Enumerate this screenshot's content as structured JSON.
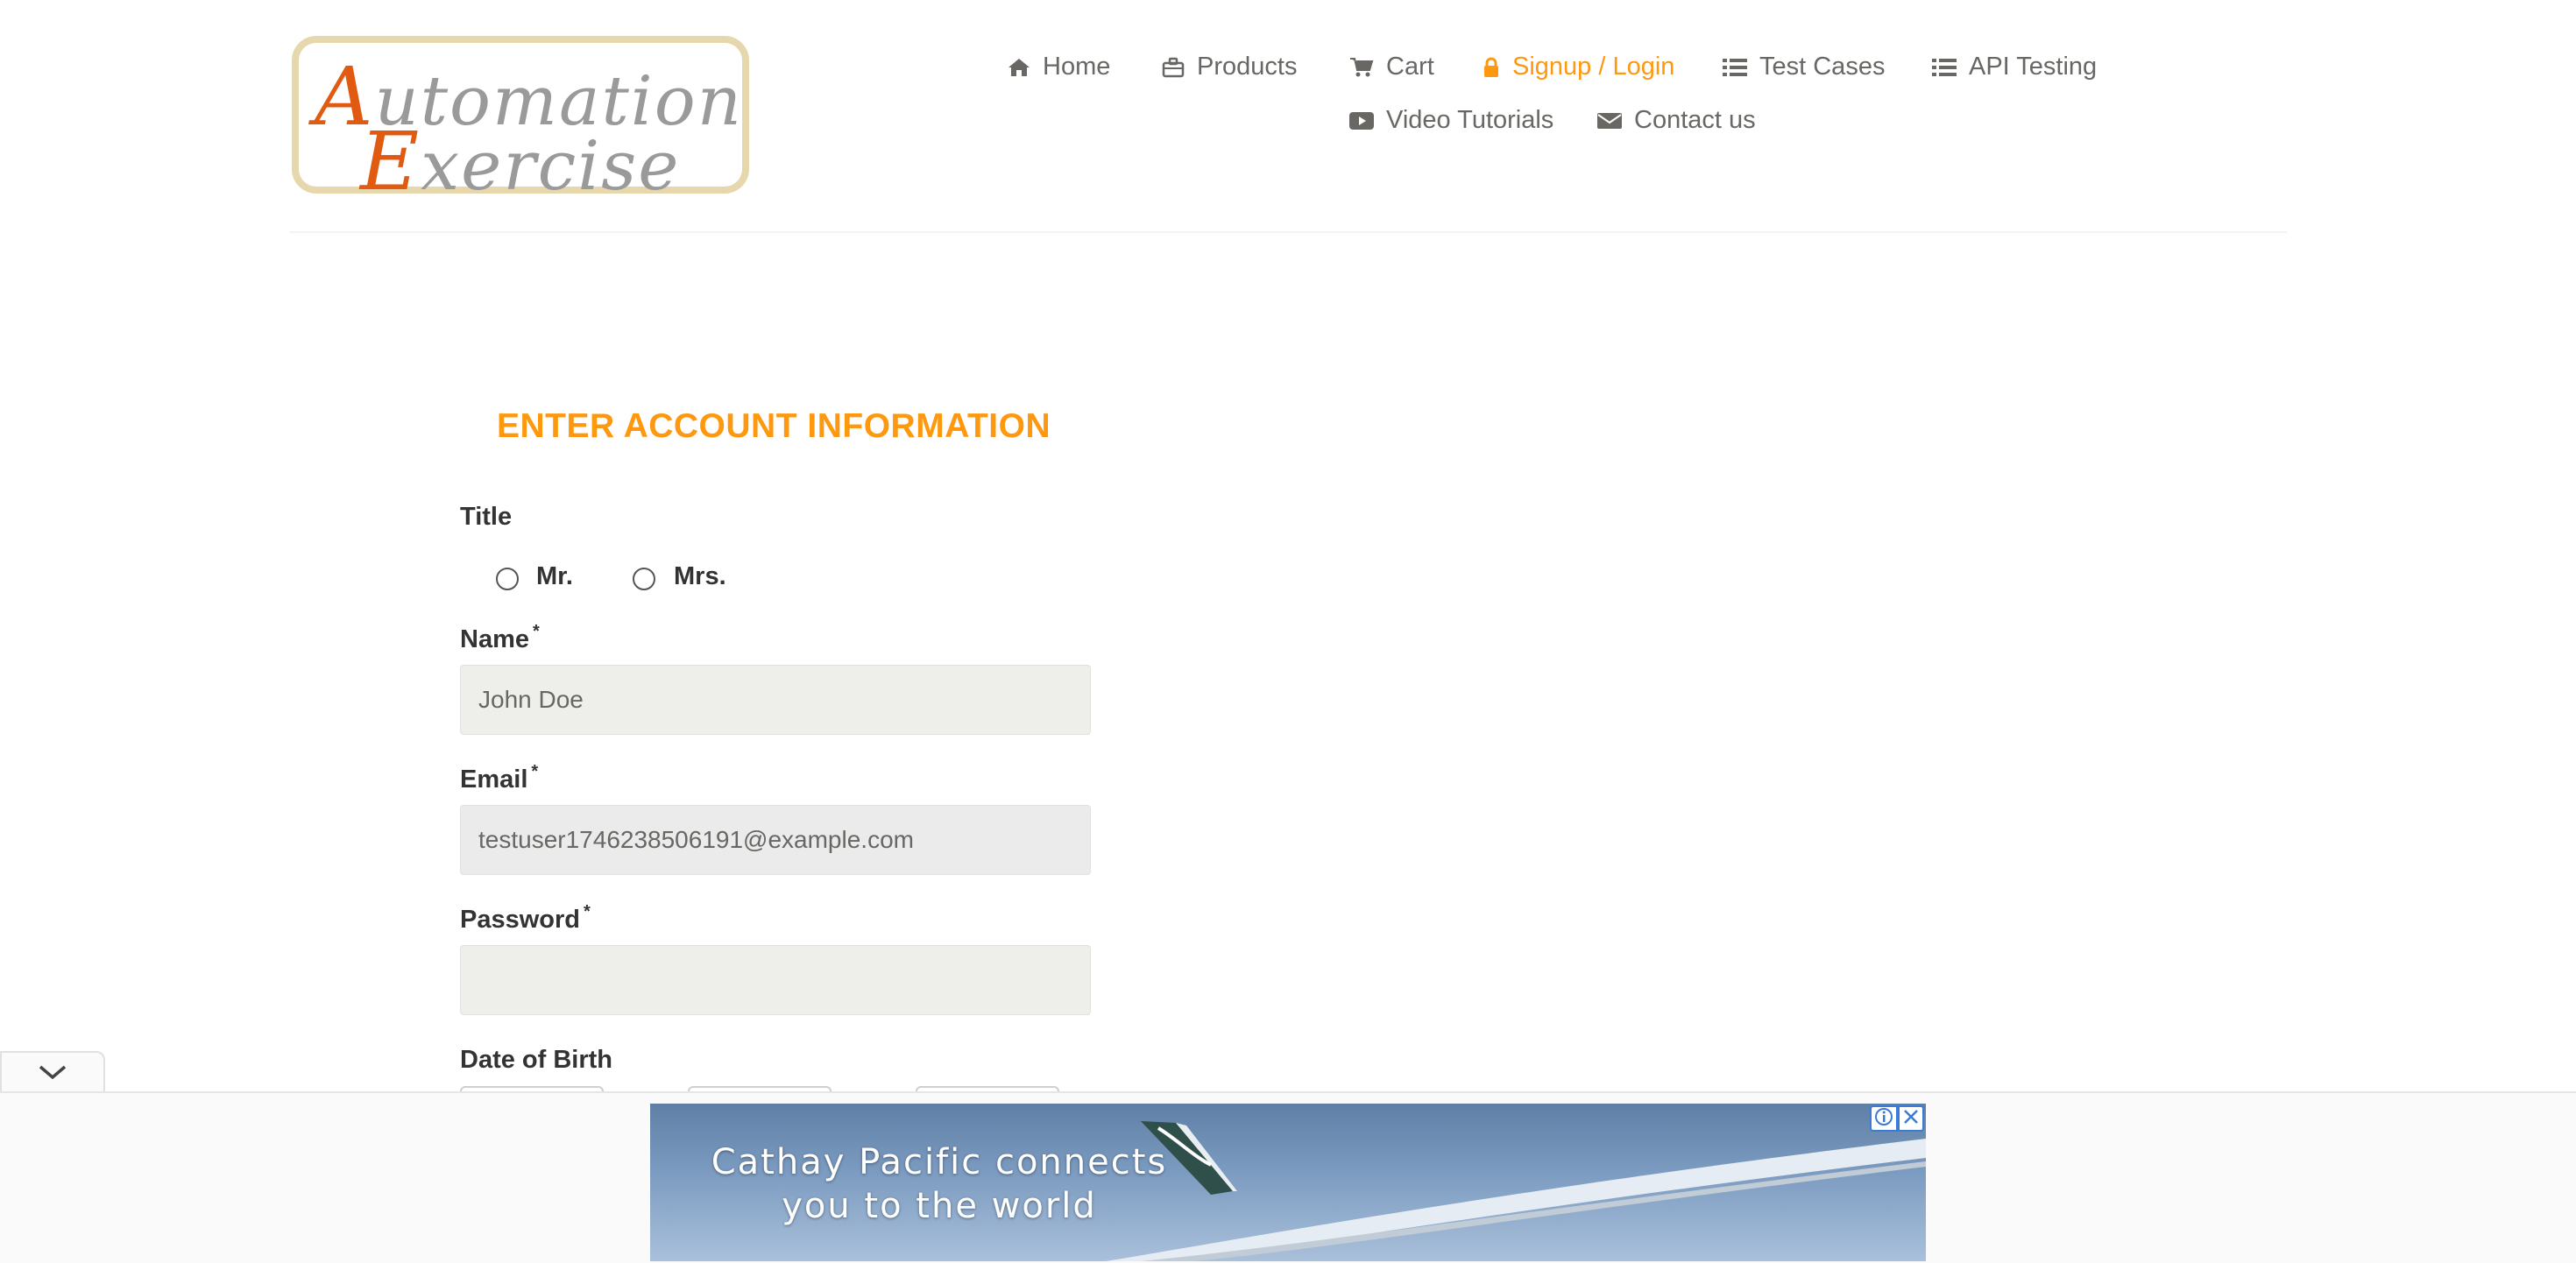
{
  "logo": {
    "line1_cap": "A",
    "line1_rest": "utomation",
    "line2_cap": "E",
    "line2_rest": "xercise"
  },
  "nav": {
    "items": [
      {
        "label": "Home",
        "icon": "home-icon"
      },
      {
        "label": "Products",
        "icon": "briefcase-icon"
      },
      {
        "label": "Cart",
        "icon": "cart-icon"
      },
      {
        "label": "Signup / Login",
        "icon": "lock-icon",
        "active": true
      },
      {
        "label": "Test Cases",
        "icon": "list-icon"
      },
      {
        "label": "API Testing",
        "icon": "list-icon"
      },
      {
        "label": "Video Tutorials",
        "icon": "youtube-play-icon"
      },
      {
        "label": "Contact us",
        "icon": "envelope-icon"
      }
    ],
    "active_color": "#fe980f"
  },
  "form": {
    "section_title": "ENTER ACCOUNT INFORMATION",
    "title_label": "Title",
    "radio_options": [
      "Mr.",
      "Mrs."
    ],
    "name_label": "Name",
    "name_value": "John Doe",
    "email_label": "Email",
    "email_value": "testuser1746238506191@example.com",
    "password_label": "Password",
    "password_value": "",
    "dob_label": "Date of Birth",
    "required_mark": "*"
  },
  "ad": {
    "line1": "Cathay Pacific connects",
    "line2": "you to the world",
    "info_icon": "info-icon",
    "close_icon": "close-icon",
    "collapse_icon": "chevron-down-icon"
  }
}
